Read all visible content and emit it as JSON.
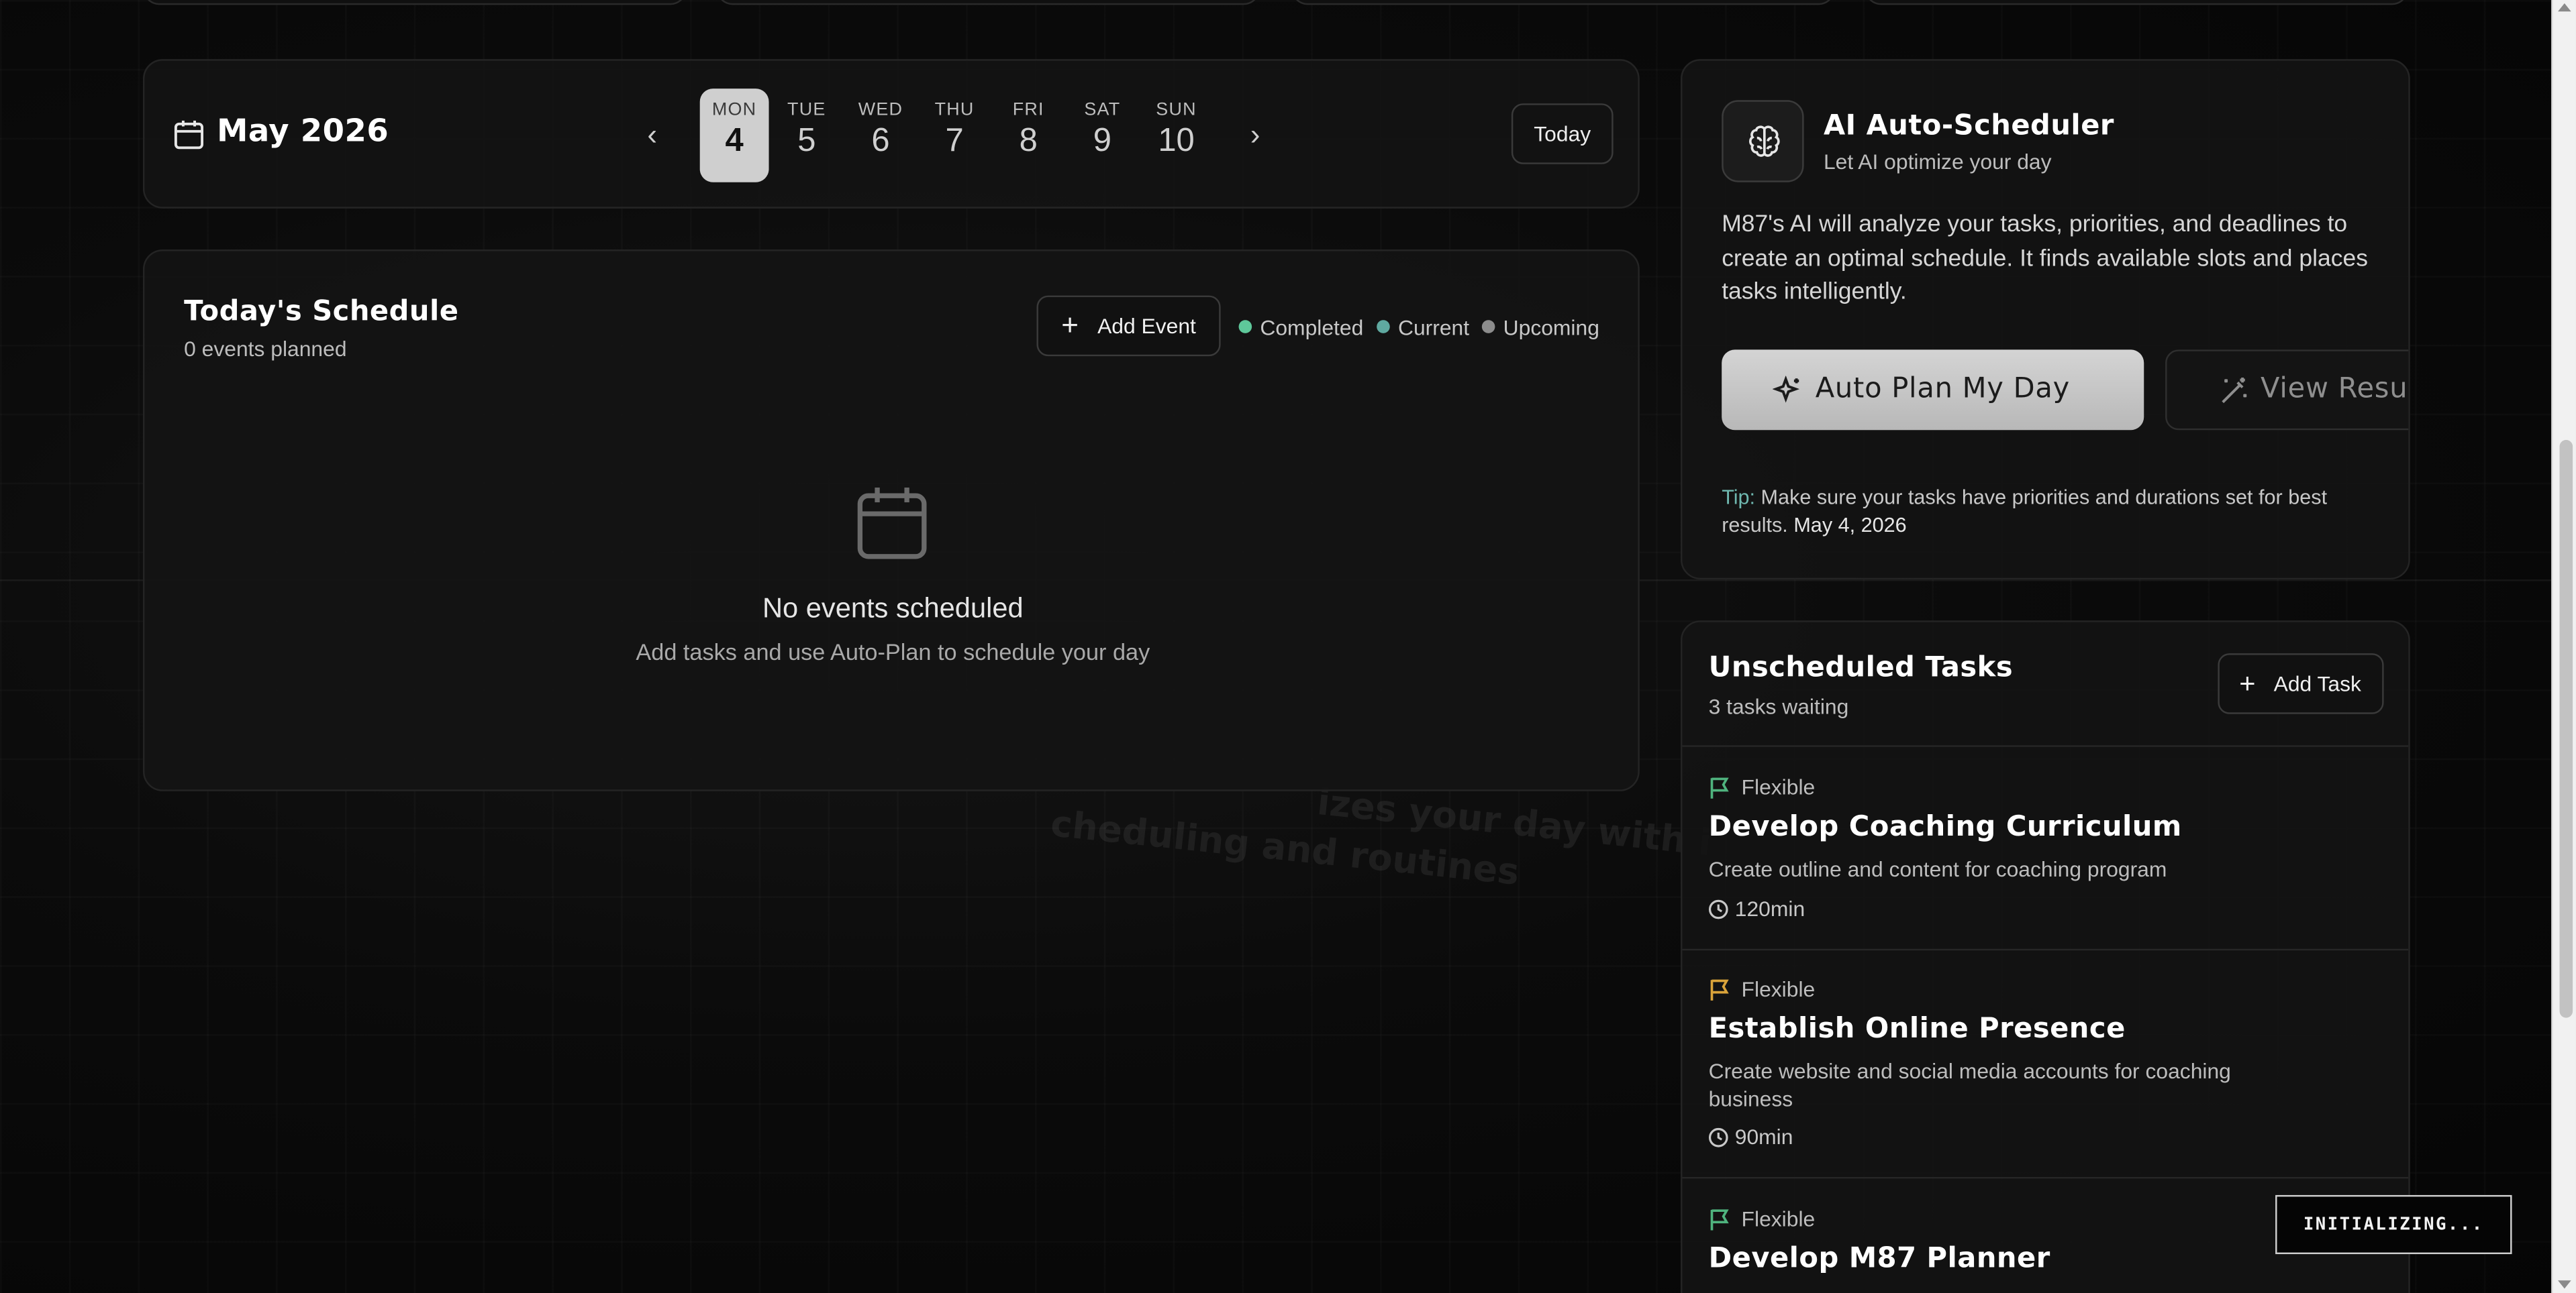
{
  "header": {
    "month_label": "May 2026",
    "today_label": "Today",
    "days": [
      {
        "name": "MON",
        "date": "4",
        "selected": true
      },
      {
        "name": "TUE",
        "date": "5",
        "selected": false
      },
      {
        "name": "WED",
        "date": "6",
        "selected": false
      },
      {
        "name": "THU",
        "date": "7",
        "selected": false
      },
      {
        "name": "FRI",
        "date": "8",
        "selected": false
      },
      {
        "name": "SAT",
        "date": "9",
        "selected": false
      },
      {
        "name": "SUN",
        "date": "10",
        "selected": false
      }
    ]
  },
  "schedule": {
    "title": "Today's Schedule",
    "subtitle": "0 events planned",
    "add_event_label": "Add Event",
    "legend": [
      {
        "label": "Completed",
        "color": "#5ec79a"
      },
      {
        "label": "Current",
        "color": "#5fa9a0"
      },
      {
        "label": "Upcoming",
        "color": "#8c8c8c"
      }
    ],
    "empty_title": "No events scheduled",
    "empty_subtitle": "Add tasks and use Auto-Plan to schedule your day"
  },
  "background_text": {
    "line1": "izes your day with i",
    "line2": "cheduling and routines"
  },
  "ai": {
    "title": "AI Auto-Scheduler",
    "subtitle": "Let AI optimize your day",
    "description": "M87's AI will analyze your tasks, priorities, and deadlines to create an optimal schedule. It finds available slots and places tasks intelligently.",
    "auto_button": "Auto Plan My Day",
    "view_button": "View Results",
    "tip_label": "Tip:",
    "tip_text": " Make sure your tasks have priorities and durations set for best results. ",
    "tip_date": "May 4, 2026"
  },
  "tasks": {
    "title": "Unscheduled Tasks",
    "subtitle": "3 tasks waiting",
    "add_task_label": "Add Task",
    "items": [
      {
        "priority": "Flexible",
        "flag_color": "#4fb37e",
        "name": "Develop Coaching Curriculum",
        "description": "Create outline and content for coaching program",
        "duration": "120min"
      },
      {
        "priority": "Flexible",
        "flag_color": "#d9a33a",
        "name": "Establish Online Presence",
        "description": "Create website and social media accounts for coaching business",
        "duration": "90min"
      },
      {
        "priority": "Flexible",
        "flag_color": "#4fb37e",
        "name": "Develop M87 Planner",
        "description": "",
        "duration": ""
      }
    ]
  },
  "status": {
    "initializing": "INITIALIZING..."
  },
  "colors": {
    "background": "#050505",
    "card": "#141414",
    "accent_selected": "#cfcfcf",
    "tip_accent": "#6fb8b0"
  }
}
